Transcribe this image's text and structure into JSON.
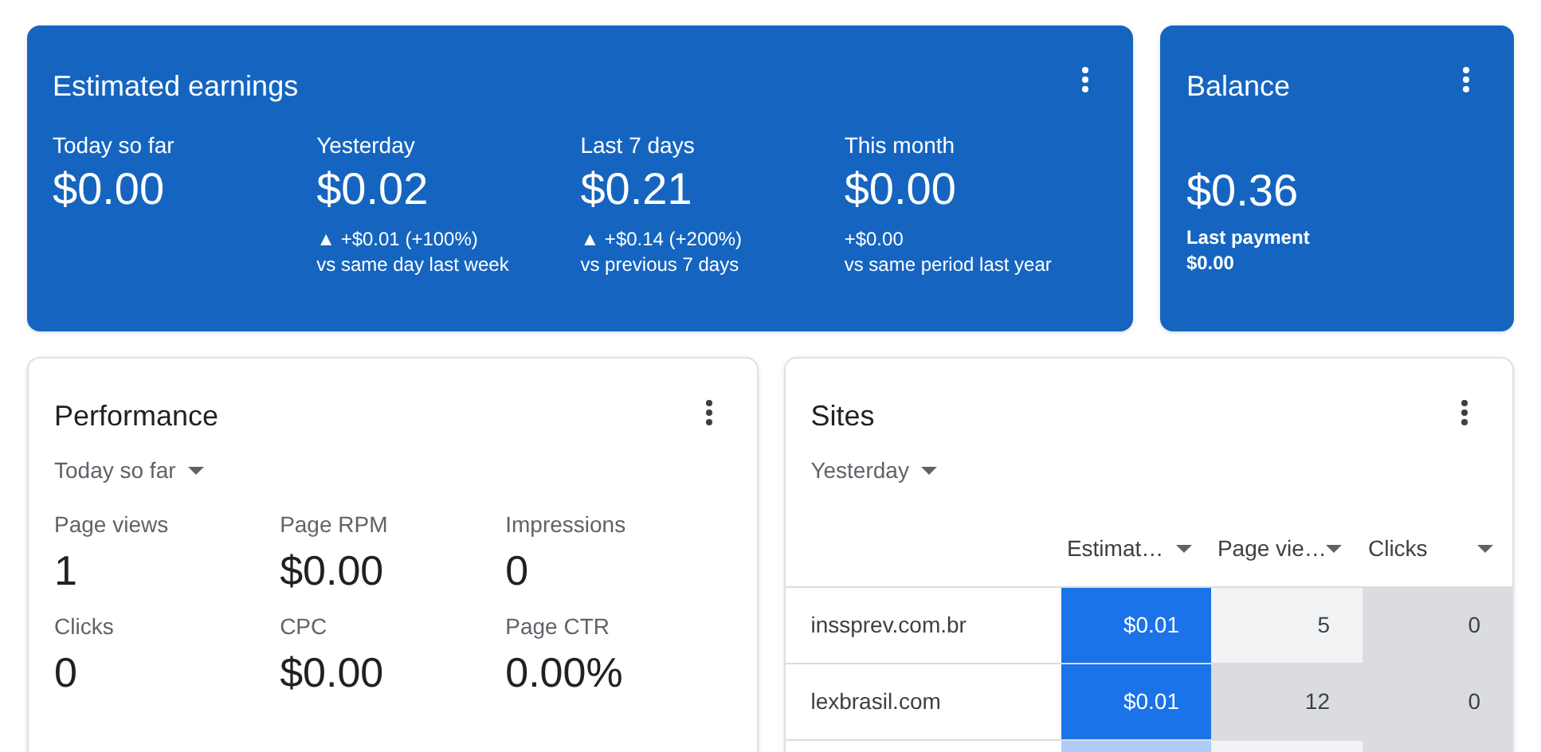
{
  "earnings": {
    "title": "Estimated earnings",
    "metrics": [
      {
        "label": "Today so far",
        "value": "$0.00"
      },
      {
        "label": "Yesterday",
        "value": "$0.02",
        "change": "▲ +$0.01 (+100%)",
        "comparison": "vs same day last week"
      },
      {
        "label": "Last 7 days",
        "value": "$0.21",
        "change": "▲ +$0.14 (+200%)",
        "comparison": "vs previous 7 days"
      },
      {
        "label": "This month",
        "value": "$0.00",
        "change": "+$0.00",
        "comparison": "vs same period last year"
      }
    ]
  },
  "balance": {
    "title": "Balance",
    "value": "$0.36",
    "last_payment_label": "Last payment",
    "last_payment": "$0.00"
  },
  "performance": {
    "title": "Performance",
    "period": "Today so far",
    "metrics": [
      {
        "label": "Page views",
        "value": "1"
      },
      {
        "label": "Page RPM",
        "value": "$0.00"
      },
      {
        "label": "Impressions",
        "value": "0"
      },
      {
        "label": "Clicks",
        "value": "0"
      },
      {
        "label": "CPC",
        "value": "$0.00"
      },
      {
        "label": "Page CTR",
        "value": "0.00%"
      }
    ]
  },
  "sites": {
    "title": "Sites",
    "period": "Yesterday",
    "table": {
      "columns": [
        "Estimat…",
        "Page vie…",
        "Clicks"
      ],
      "rows": [
        {
          "site": "inssprev.com.br",
          "cells": [
            {
              "value": "$0.01",
              "color": "#1a73e8"
            },
            {
              "value": "5",
              "color": "#f1f3f4"
            },
            {
              "value": "0",
              "color": "#dadce0"
            }
          ]
        },
        {
          "site": "lexbrasil.com",
          "cells": [
            {
              "value": "$0.01",
              "color": "#1a73e8"
            },
            {
              "value": "12",
              "color": "#dadce0"
            },
            {
              "value": "0",
              "color": "#dadce0"
            }
          ]
        },
        {
          "cells": [
            {
              "color": "#aecbfa"
            },
            {
              "color": "#f1f3f4"
            },
            {
              "color": "#dadce0"
            }
          ]
        }
      ]
    }
  }
}
